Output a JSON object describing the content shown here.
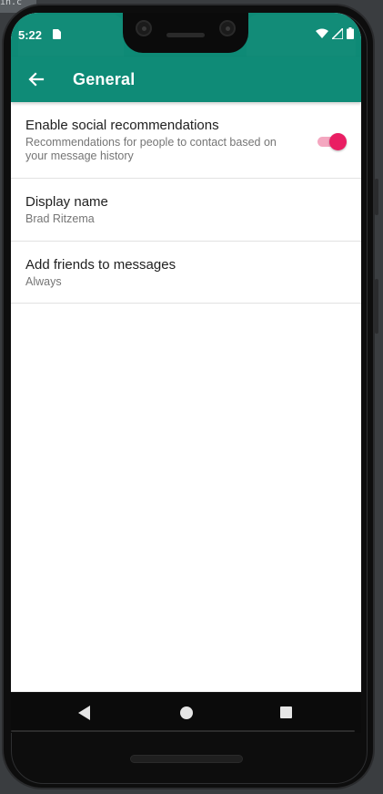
{
  "background_text": "in.c",
  "status_bar": {
    "time": "5:22",
    "icons": [
      "sd-card-icon",
      "wifi-icon",
      "signal-icon",
      "battery-icon"
    ]
  },
  "app_bar": {
    "title": "General",
    "back_icon": "arrow-left-icon"
  },
  "settings": [
    {
      "title": "Enable social recommendations",
      "summary": "Recommendations for people to contact based on your message history",
      "toggle_on": true
    },
    {
      "title": "Display name",
      "summary": "Brad Ritzema"
    },
    {
      "title": "Add friends to messages",
      "summary": "Always"
    }
  ],
  "colors": {
    "primary": "#0f8b77",
    "accent": "#e91e63",
    "accent_track": "#f4a7c0",
    "text_primary": "#212121",
    "text_secondary": "#757575"
  },
  "nav_bar": {
    "buttons": [
      "nav-back-icon",
      "nav-home-icon",
      "nav-recents-icon"
    ]
  }
}
